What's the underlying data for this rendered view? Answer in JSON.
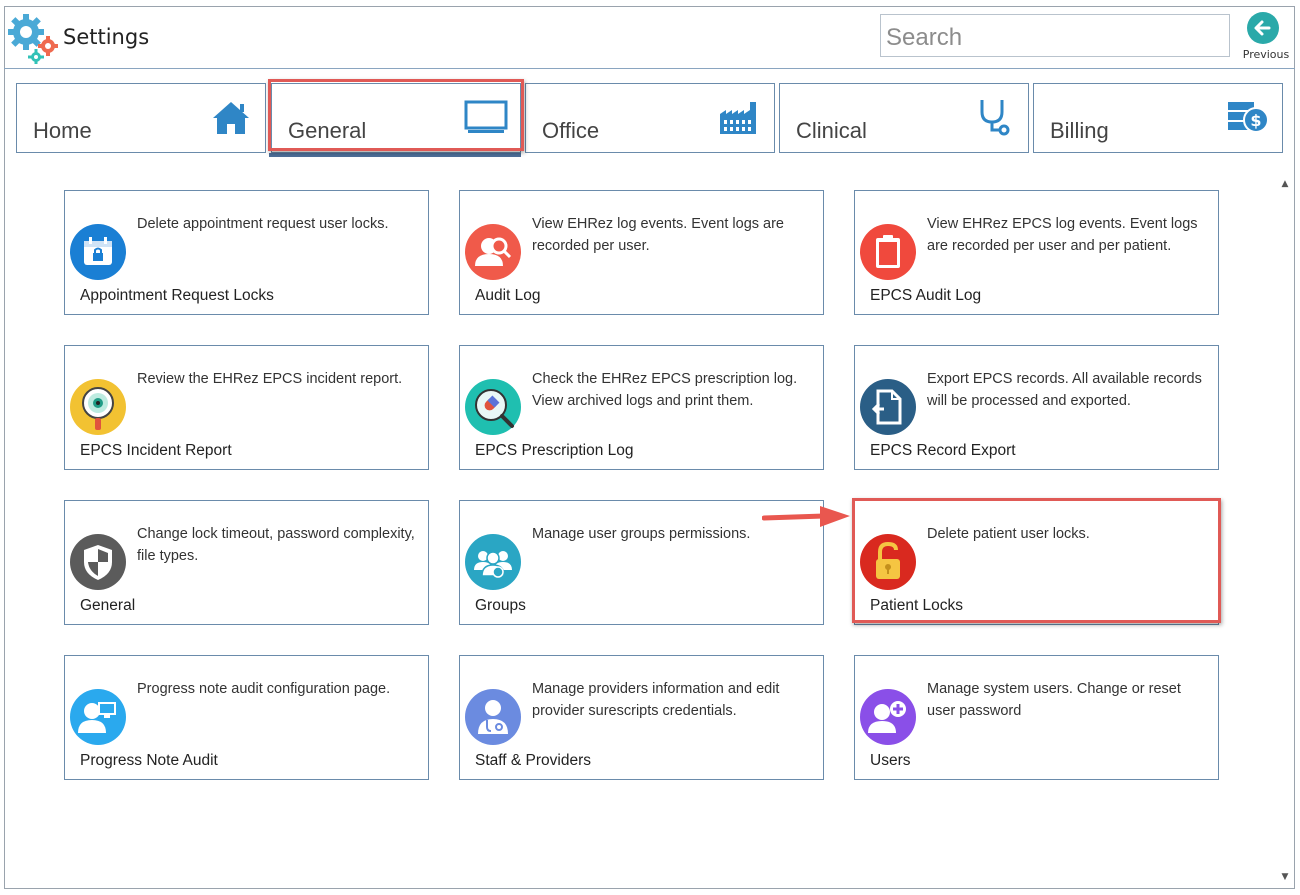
{
  "app": {
    "title": "Settings",
    "icon": "gears-icon"
  },
  "search": {
    "placeholder": "Search"
  },
  "previous": {
    "label": "Previous",
    "icon": "arrow-left-icon"
  },
  "tabs": [
    {
      "label": "Home",
      "icon": "home-icon"
    },
    {
      "label": "General",
      "icon": "monitor-icon",
      "active": true,
      "highlighted": true
    },
    {
      "label": "Office",
      "icon": "factory-icon"
    },
    {
      "label": "Clinical",
      "icon": "stethoscope-icon"
    },
    {
      "label": "Billing",
      "icon": "billing-icon"
    }
  ],
  "cards": [
    {
      "title": "Appointment Request Locks",
      "desc": "Delete appointment request user locks.",
      "icon": "calendar-lock-icon",
      "color": "#1a7fd4"
    },
    {
      "title": "Audit Log",
      "desc": "View EHRez log events. Event logs are recorded per user.",
      "icon": "user-search-icon",
      "color": "#f05a4a"
    },
    {
      "title": "EPCS Audit Log",
      "desc": "View EHRez EPCS log events. Event logs are recorded per user and per patient.",
      "icon": "clipboard-icon",
      "color": "#f0493d"
    },
    {
      "title": "EPCS Incident Report",
      "desc": "Review the EHRez EPCS incident report.",
      "icon": "magnifier-eye-icon",
      "color": "#f2c232"
    },
    {
      "title": "EPCS Prescription Log",
      "desc": "Check the EHRez EPCS prescription log. View archived logs and print them.",
      "icon": "pill-magnifier-icon",
      "color": "#1fbfb0"
    },
    {
      "title": "EPCS Record Export",
      "desc": "Export EPCS records. All available records will be processed and exported.",
      "icon": "document-export-icon",
      "color": "#2a5e86"
    },
    {
      "title": "General",
      "desc": "Change lock timeout, password complexity, file types.",
      "icon": "shield-icon",
      "color": "#5b5b5b"
    },
    {
      "title": "Groups",
      "desc": "Manage user groups permissions.",
      "icon": "user-group-icon",
      "color": "#2aa6c4"
    },
    {
      "title": "Patient Locks",
      "desc": "Delete patient user locks.",
      "icon": "open-lock-icon",
      "color": "#d9291f",
      "highlighted": true
    },
    {
      "title": "Progress Note Audit",
      "desc": "Progress note audit configuration page.",
      "icon": "user-monitor-icon",
      "color": "#2aa9ee"
    },
    {
      "title": "Staff & Providers",
      "desc": "Manage providers information and edit provider surescripts credentials.",
      "icon": "doctor-icon",
      "color": "#6b8be0"
    },
    {
      "title": "Users",
      "desc": "Manage system users. Change or reset user password",
      "icon": "user-add-icon",
      "color": "#8a4fe8"
    }
  ],
  "scrollbar": {
    "up": "▲",
    "down": "▼"
  },
  "colors": {
    "highlight": "#e05a56",
    "accent": "#4d6f99",
    "border": "#6a8bab"
  }
}
